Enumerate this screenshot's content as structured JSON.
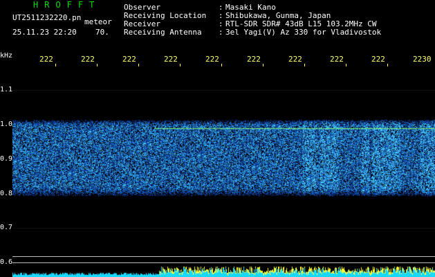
{
  "app": {
    "title": "HROFFT",
    "file_name": "UT2511232220.pn",
    "mode": "meteor",
    "date_time": "25.11.23 22:20",
    "count": "70."
  },
  "info": [
    {
      "label": "Observer",
      "value": "Masaki Kano"
    },
    {
      "label": "Receiving Location",
      "value": "Shibukawa, Gunma, Japan"
    },
    {
      "label": "Receiver",
      "value": "RTL-SDR SDR# 43dB L15 103.2MHz CW"
    },
    {
      "label": "Receiving Antenna",
      "value": "3el Yagi(V) Az 330 for Vladivostok"
    }
  ],
  "axis": {
    "unit": "kHz",
    "time_ticks": [
      "222",
      "222",
      "222",
      "222",
      "222",
      "222",
      "222",
      "222",
      "222",
      "2230"
    ],
    "freq_ticks": [
      "1.1",
      "1.0",
      "0.9",
      "0.8",
      "0.7",
      "0.6"
    ]
  },
  "colors": {
    "background": "#000000",
    "title": "#00e000",
    "tick": "#ffff66",
    "signal_line": "#9cff3a",
    "noise_low": "#0a1e8c",
    "noise_high": "#4fb3ff",
    "histogram_low": "#19d8ff",
    "histogram_high": "#ffff33"
  }
}
